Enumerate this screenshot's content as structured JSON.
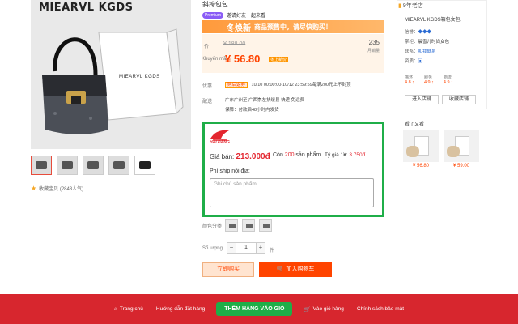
{
  "product": {
    "brand_title": "MIEARVL KGDS",
    "box_text": "MIEARVL KGDS",
    "title": "斜挎包包",
    "tag_badge": "Premium",
    "tag_text": "邀请好友一起来看",
    "favorites": "收藏宝贝 (2843人气)",
    "thumbnails": [
      "thumb-1",
      "thumb-2",
      "thumb-3",
      "thumb-4",
      "thumb-5"
    ]
  },
  "promo": {
    "banner_big": "冬焕新",
    "banner_text": "商品预售中，请尽快购买！"
  },
  "price": {
    "original_label": "价",
    "original": "¥ 188.00",
    "sale_label": "Khuyến mãi",
    "sale": "¥ 56.80",
    "sale_tag": "冬上新价",
    "sold_count": "235",
    "sold_label": "月销量"
  },
  "info_rows": {
    "promo_label": "优惠",
    "promo_chip": "购后返券",
    "promo_text": "10/10 00:00:00-10/12 23:59:59每满200元上不封顶",
    "shipping_label": "配送",
    "shipping_text": "广东广州至 广西崇左扶绥县  快递 免运费",
    "guarantee_text": "保障：付款后48小时内发货"
  },
  "extension": {
    "logo_text": "HẢI ĐĂNG",
    "price_label": "Giá bán: ",
    "price_value": "213.000đ",
    "stock_prefix": "Còn ",
    "stock_count": "200",
    "stock_suffix": " sản phẩm",
    "rate_label": "Tỷ giá 1¥: ",
    "rate_value": "3.750đ",
    "note_label": "Phí ship nội địa:",
    "note_placeholder": "Ghi chú sản phẩm"
  },
  "options": {
    "color_label": "颜色分类",
    "quantity_label": "Số lượng",
    "quantity_value": "1",
    "minus": "−",
    "plus": "+",
    "unit": "件",
    "buy_now": "立即购买",
    "add_to_cart": "加入购物车"
  },
  "shop": {
    "years": "9年老店",
    "name": "MIEARVL KGDS箱包女包",
    "credit_label": "信誉：",
    "seller_label": "掌柜：",
    "seller_value": "晨雪儿时尚女包",
    "contact_label": "联系：",
    "contact_value": "和我联系",
    "qual_label": "资质：",
    "stats": [
      {
        "label": "描述",
        "value": "4.8 ↑"
      },
      {
        "label": "服务",
        "value": "4.9 ↑"
      },
      {
        "label": "物流",
        "value": "4.9 ↑"
      }
    ],
    "enter_shop": "进入店铺",
    "favorite_shop": "收藏店铺",
    "also_viewed_title": "看了又看",
    "also_viewed": [
      {
        "price": "¥ 56.80"
      },
      {
        "price": "¥ 59.00"
      }
    ]
  },
  "bottom_nav": {
    "home": "Trang chủ",
    "guide": "Hướng dẫn đặt hàng",
    "cta": "THÊM HÀNG VÀO GIỎ",
    "cart": "Vào giỏ hàng",
    "policy": "Chính sách bảo mật"
  },
  "colors": {
    "accent": "#ff4400",
    "extension_border": "#1fae48",
    "bottom_bar": "#d7262e"
  }
}
